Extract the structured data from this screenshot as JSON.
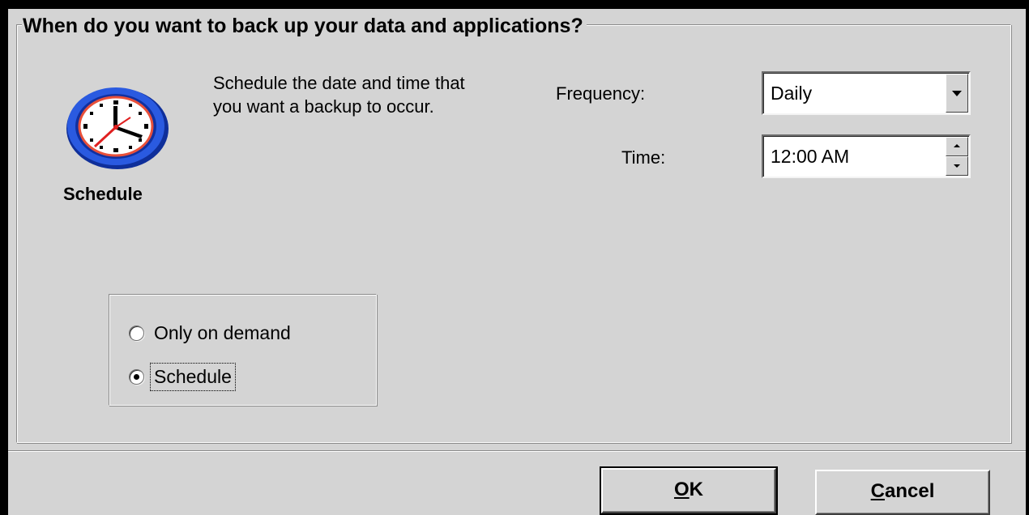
{
  "group": {
    "title": "When do you want to back up your data and applications?"
  },
  "icon": {
    "name": "clock-icon",
    "caption": "Schedule"
  },
  "description": "Schedule the date and time that you want a backup to occur.",
  "frequency": {
    "label": "Frequency:",
    "value": "Daily"
  },
  "time": {
    "label": "Time:",
    "value": "12:00 AM"
  },
  "radios": {
    "option1": {
      "label": "Only on demand",
      "selected": false
    },
    "option2": {
      "label": "Schedule",
      "selected": true
    }
  },
  "buttons": {
    "ok_underlined": "O",
    "ok_rest": "K",
    "cancel_underlined": "C",
    "cancel_rest": "ancel"
  },
  "colors": {
    "face": "#d4d4d4",
    "frame": "#000000",
    "clock_ring": "#1f4fd0",
    "clock_hand_red": "#e02020"
  }
}
